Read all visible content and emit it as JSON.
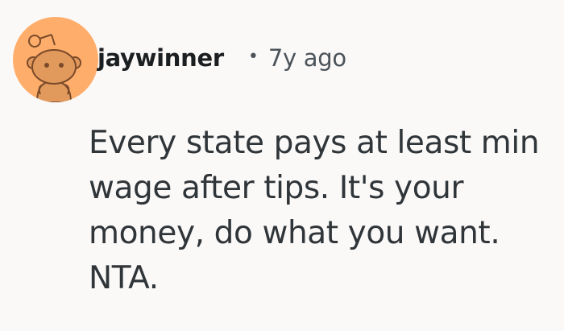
{
  "comment": {
    "author": "jaywinner",
    "separator": "•",
    "timestamp": "7y ago",
    "avatar_icon": "reddit-snoo-avatar-icon",
    "avatar_color": "#ffad6a",
    "body": "Every state pays at least min wage after tips. It's your money, do what you want. NTA."
  }
}
